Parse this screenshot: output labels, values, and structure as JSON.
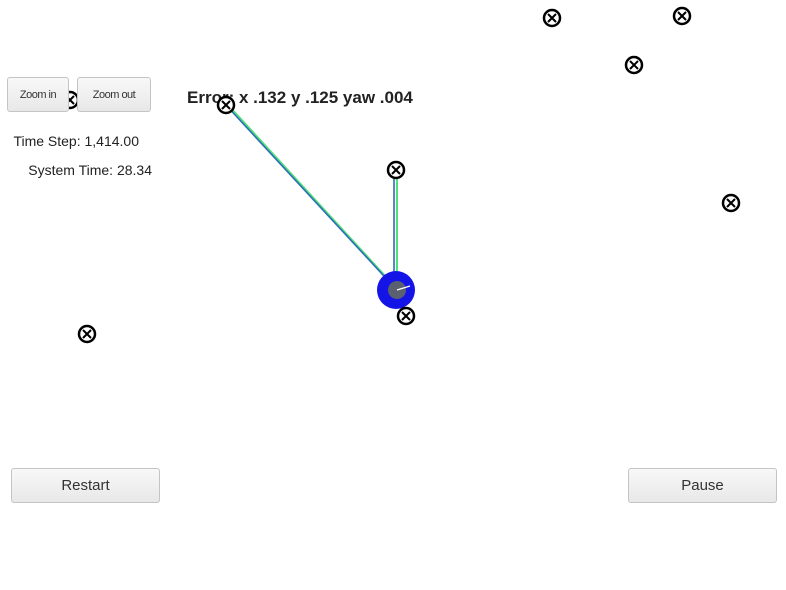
{
  "controls": {
    "zoom_in_label": "Zoom in",
    "zoom_out_label": "Zoom out",
    "restart_label": "Restart",
    "pause_label": "Pause"
  },
  "status": {
    "error_text": "Error: x .132 y .125 yaw .004",
    "time_step_text": "Time Step: 1,414.00",
    "system_time_text": "System Time: 28.34"
  },
  "icons": {
    "landmark": "landmark-marker-icon",
    "vehicle": "vehicle-icon"
  },
  "colors": {
    "vehicle_fill": "#1414e6",
    "vehicle_inner": "#5a6070",
    "observation_line": "#2a6fb5",
    "ground_truth_line": "#52e07a",
    "landmark_stroke": "#000000"
  }
}
